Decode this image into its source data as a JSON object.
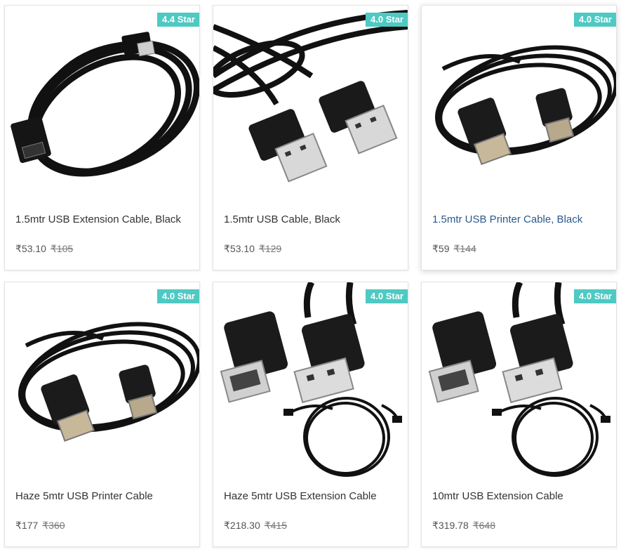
{
  "products": [
    {
      "rating": "4.4 Star",
      "title": "1.5mtr USB Extension Cable, Black",
      "price": "₹53.10",
      "mrp": "₹105",
      "image_icon": "usb-extension-cable-coil-icon"
    },
    {
      "rating": "4.0 Star",
      "title": "1.5mtr USB Cable, Black",
      "price": "₹53.10",
      "mrp": "₹129",
      "image_icon": "usb-a-cable-icon"
    },
    {
      "rating": "4.0 Star",
      "title": "1.5mtr USB Printer Cable, Black",
      "price": "₹59",
      "mrp": "₹144",
      "image_icon": "usb-printer-cable-icon"
    },
    {
      "rating": "4.0 Star",
      "title": "Haze 5mtr USB Printer Cable",
      "price": "₹177",
      "mrp": "₹360",
      "image_icon": "usb-printer-cable-icon"
    },
    {
      "rating": "4.0 Star",
      "title": "Haze 5mtr USB Extension Cable",
      "price": "₹218.30",
      "mrp": "₹415",
      "image_icon": "usb-extension-cable-icon"
    },
    {
      "rating": "4.0 Star",
      "title": "10mtr USB Extension Cable",
      "price": "₹319.78",
      "mrp": "₹648",
      "image_icon": "usb-extension-cable-icon"
    }
  ],
  "colors": {
    "badge": "#4ec9c3",
    "title": "#333333",
    "title_hover": "#2a5a8c",
    "mrp": "#7a7a7a"
  }
}
